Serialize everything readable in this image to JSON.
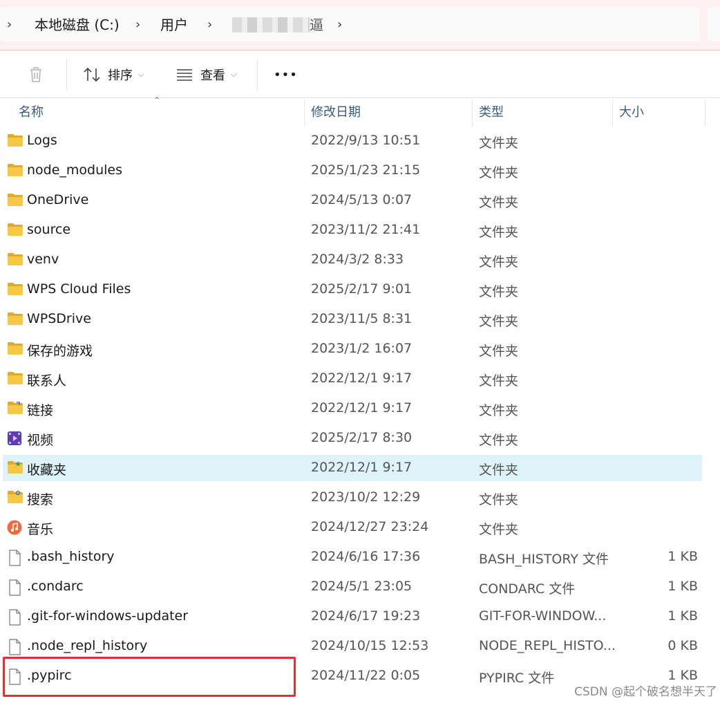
{
  "breadcrumb": {
    "items": [
      "本地磁盘 (C:)",
      "用户",
      "逼"
    ],
    "separator": ">"
  },
  "toolbar": {
    "delete_icon": "trash-icon",
    "sort_label": "排序",
    "view_label": "查看",
    "more_label": "•••"
  },
  "columns": {
    "name": "名称",
    "date": "修改日期",
    "type": "类型",
    "size": "大小"
  },
  "files": [
    {
      "name": "Logs",
      "date": "2022/9/13 10:51",
      "type": "文件夹",
      "size": "",
      "icon": "folder-icon"
    },
    {
      "name": "node_modules",
      "date": "2025/1/23 21:15",
      "type": "文件夹",
      "size": "",
      "icon": "folder-icon"
    },
    {
      "name": "OneDrive",
      "date": "2024/5/13 0:07",
      "type": "文件夹",
      "size": "",
      "icon": "folder-icon"
    },
    {
      "name": "source",
      "date": "2023/11/2 21:41",
      "type": "文件夹",
      "size": "",
      "icon": "folder-icon"
    },
    {
      "name": "venv",
      "date": "2024/3/2 8:33",
      "type": "文件夹",
      "size": "",
      "icon": "folder-icon"
    },
    {
      "name": "WPS Cloud Files",
      "date": "2025/2/17 9:01",
      "type": "文件夹",
      "size": "",
      "icon": "folder-icon"
    },
    {
      "name": "WPSDrive",
      "date": "2023/11/5 8:31",
      "type": "文件夹",
      "size": "",
      "icon": "folder-icon"
    },
    {
      "name": "保存的游戏",
      "date": "2023/1/2 16:07",
      "type": "文件夹",
      "size": "",
      "icon": "folder-icon"
    },
    {
      "name": "联系人",
      "date": "2022/12/1 9:17",
      "type": "文件夹",
      "size": "",
      "icon": "folder-icon"
    },
    {
      "name": "链接",
      "date": "2022/12/1 9:17",
      "type": "文件夹",
      "size": "",
      "icon": "folder-link-icon"
    },
    {
      "name": "视频",
      "date": "2025/2/17 8:30",
      "type": "文件夹",
      "size": "",
      "icon": "video-folder-icon"
    },
    {
      "name": "收藏夹",
      "date": "2022/12/1 9:17",
      "type": "文件夹",
      "size": "",
      "icon": "folder-star-icon",
      "selected": true
    },
    {
      "name": "搜索",
      "date": "2023/10/2 12:29",
      "type": "文件夹",
      "size": "",
      "icon": "folder-search-icon"
    },
    {
      "name": "音乐",
      "date": "2024/12/27 23:24",
      "type": "文件夹",
      "size": "",
      "icon": "music-folder-icon"
    },
    {
      "name": ".bash_history",
      "date": "2024/6/16 17:36",
      "type": "BASH_HISTORY 文件",
      "size": "1 KB",
      "icon": "file-icon"
    },
    {
      "name": ".condarc",
      "date": "2024/5/1 23:05",
      "type": "CONDARC 文件",
      "size": "1 KB",
      "icon": "file-icon"
    },
    {
      "name": ".git-for-windows-updater",
      "date": "2024/6/17 19:23",
      "type": "GIT-FOR-WINDOW...",
      "size": "1 KB",
      "icon": "file-icon"
    },
    {
      "name": ".node_repl_history",
      "date": "2024/10/15 12:53",
      "type": "NODE_REPL_HISTO...",
      "size": "0 KB",
      "icon": "file-icon"
    },
    {
      "name": ".pypirc",
      "date": "2024/11/22 0:05",
      "type": "PYPIRC 文件",
      "size": "1 KB",
      "icon": "file-icon"
    }
  ],
  "watermark": "CSDN @起个破名想半天了",
  "colors": {
    "selected_row": "#dff3fa",
    "highlight_border": "#e53030",
    "folder_yellow": "#f7c844",
    "column_header": "#3c5a80"
  }
}
